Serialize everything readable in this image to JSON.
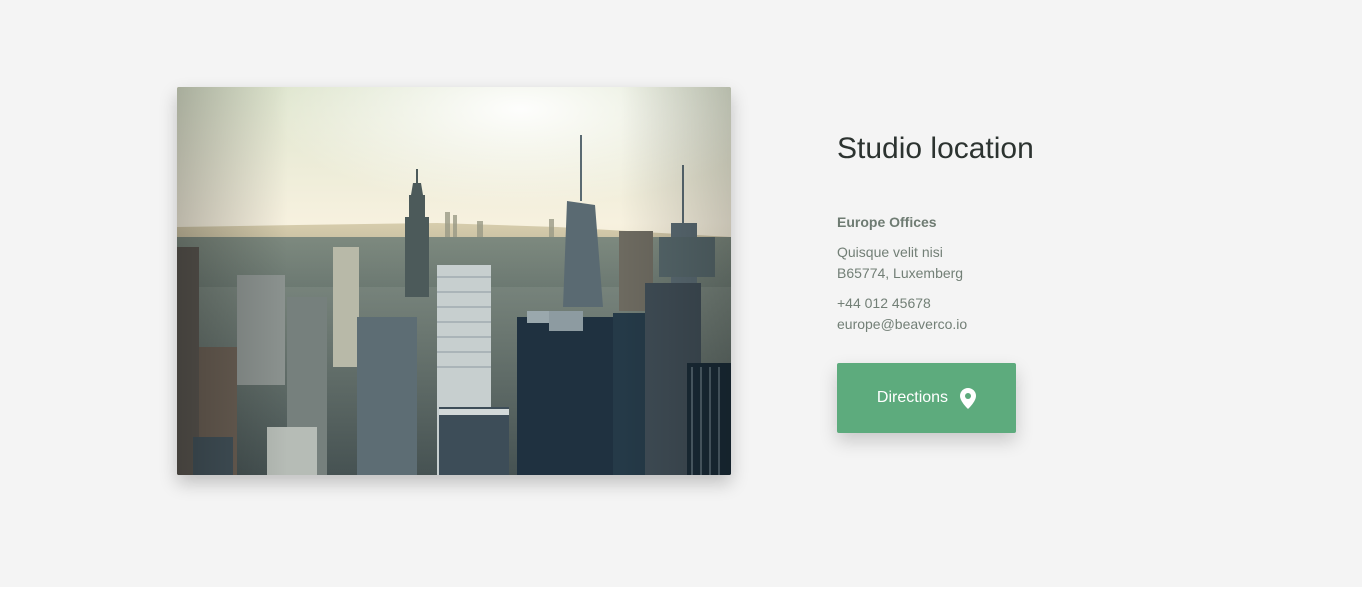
{
  "location": {
    "title": "Studio location",
    "office_name": "Europe Offices",
    "address_line_1": "Quisque velit nisi",
    "address_line_2": "B65774, Luxemberg",
    "phone": "+44 012 45678",
    "email": "europe@beaverco.io",
    "directions_label": "Directions",
    "directions_icon": "map-pin-icon",
    "accent_color": "#5dab7d"
  },
  "photo": {
    "subject": "city-skyline-photo"
  }
}
